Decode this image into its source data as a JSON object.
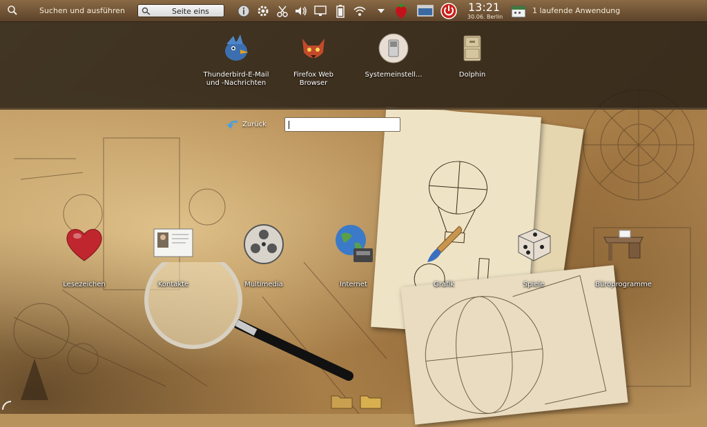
{
  "panel": {
    "run_command_label": "Suchen und ausführen",
    "search_button_label": "Seite eins",
    "clock": {
      "time": "13:21",
      "date": "30.06. Berlin"
    },
    "tasks_label": "1 laufende Anwendung",
    "tray_icons": [
      "info-icon",
      "settings-icon",
      "scissors-icon",
      "volume-icon",
      "display-icon",
      "battery-icon",
      "wifi-icon",
      "dropdown-arrow-icon",
      "strawberry-icon",
      "window-icon",
      "power-icon",
      "calendar-icon"
    ]
  },
  "favourites": [
    {
      "label": "Thunderbird-E-Mail und -Nachrichten",
      "icon": "thunderbird-icon"
    },
    {
      "label": "Firefox Web Browser",
      "icon": "firefox-icon"
    },
    {
      "label": "Systemeinstell...",
      "icon": "system-settings-icon"
    },
    {
      "label": "Dolphin",
      "icon": "dolphin-icon"
    }
  ],
  "navigation": {
    "back_label": "Zurück",
    "search_value": ""
  },
  "categories": [
    {
      "label": "Lesezeichen",
      "icon": "heart-icon"
    },
    {
      "label": "Kontakte",
      "icon": "contacts-card-icon"
    },
    {
      "label": "Multimedia",
      "icon": "film-reel-icon"
    },
    {
      "label": "Internet",
      "icon": "globe-phone-icon"
    },
    {
      "label": "Grafik",
      "icon": "paintbrush-icon"
    },
    {
      "label": "Spiele",
      "icon": "dice-icon"
    },
    {
      "label": "Büroprogramme",
      "icon": "desk-icon"
    }
  ],
  "colors": {
    "panel": "#6e5234",
    "favbar": "#231c14",
    "accent": "#ffffff"
  }
}
